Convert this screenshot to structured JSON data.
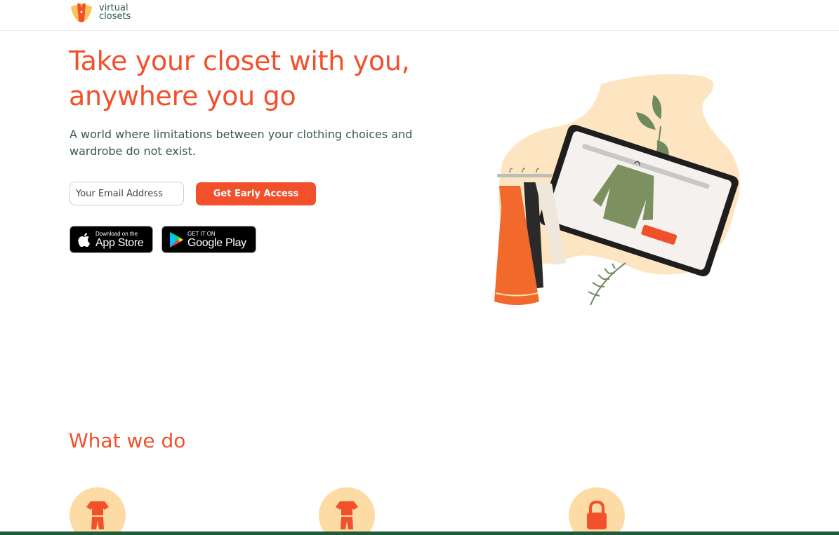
{
  "brand": {
    "name_line1": "virtual",
    "name_line2": "closets",
    "logo_icon": "hanger-logo-icon"
  },
  "hero": {
    "title": "Take your closet with you, anywhere you go",
    "subtitle": "A world where limitations between your clothing choices and wardrobe do not exist.",
    "email_placeholder": "Your Email Address",
    "cta_label": "Get Early Access"
  },
  "stores": {
    "apple": {
      "small": "Download on the",
      "big": "App Store",
      "icon": "apple-icon"
    },
    "google": {
      "small": "GET IT ON",
      "big": "Google Play",
      "icon": "google-play-icon"
    }
  },
  "what_we_do": {
    "title": "What we do",
    "features": [
      {
        "icon": "outfit-icon"
      },
      {
        "icon": "outfit-icon"
      },
      {
        "icon": "lock-icon"
      }
    ]
  },
  "colors": {
    "accent": "#f2502b",
    "text": "#3a5650",
    "feature_circle": "#fddba4",
    "footer": "#1f5c3a"
  }
}
